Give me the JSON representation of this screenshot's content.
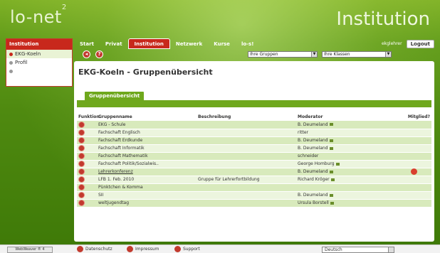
{
  "header": {
    "logo": "lo-net",
    "logo_sup": "2",
    "brand": "Institution"
  },
  "sidebar": {
    "title": "Institution",
    "items": [
      {
        "label": "EKG-Koeln",
        "active": true
      },
      {
        "label": "Profil",
        "active": false
      },
      {
        "label": "",
        "active": false
      }
    ]
  },
  "nav": {
    "tabs": [
      {
        "label": "Start"
      },
      {
        "label": "Privat"
      },
      {
        "label": "Institution",
        "active": true
      },
      {
        "label": "Netzwerk"
      },
      {
        "label": "Kurse"
      },
      {
        "label": "lo-s!"
      }
    ],
    "user": "ekglehrer",
    "logout": "Logout"
  },
  "toolbar": {
    "groups_select": "Ihre Gruppen",
    "classes_select": "Ihre Klassen"
  },
  "main": {
    "title": "EKG-Koeln - Gruppenübersicht",
    "subtab": "Gruppenübersicht",
    "columns": [
      "Funktion",
      "Gruppenname",
      "Beschreibung",
      "Moderator",
      "Mitglied?"
    ],
    "rows": [
      {
        "name": "EKG - Schule",
        "desc": "",
        "moderator": "B. Deumeland",
        "lock": true,
        "member": false,
        "link": false
      },
      {
        "name": "Fachschaft Englisch",
        "desc": "",
        "moderator": "ritter",
        "lock": false,
        "member": false,
        "link": false
      },
      {
        "name": "Fachschaft Erdkunde",
        "desc": "",
        "moderator": "B. Deumeland",
        "lock": true,
        "member": false,
        "link": false
      },
      {
        "name": "Fachschaft Informatik",
        "desc": "",
        "moderator": "B. Deumeland",
        "lock": true,
        "member": false,
        "link": false
      },
      {
        "name": "Fachschaft Mathematik",
        "desc": "",
        "moderator": "schneider",
        "lock": false,
        "member": false,
        "link": false
      },
      {
        "name": "Fachschaft Politik/Sozialwis..",
        "desc": "",
        "moderator": "George Homburg",
        "lock": true,
        "member": false,
        "link": false
      },
      {
        "name": "Lehrerkonferenz",
        "desc": "",
        "moderator": "B. Deumeland",
        "lock": true,
        "member": true,
        "link": true
      },
      {
        "name": "LFB 1. Feb. 2010",
        "desc": "Gruppe für Lehrerfortbildung",
        "moderator": "Richard Kröger",
        "lock": true,
        "member": false,
        "link": false
      },
      {
        "name": "Pünktchen & Komma",
        "desc": "",
        "moderator": "",
        "lock": false,
        "member": false,
        "link": false
      },
      {
        "name": "SII",
        "desc": "",
        "moderator": "B. Deumeland",
        "lock": true,
        "member": false,
        "link": false
      },
      {
        "name": "weltjugendtag",
        "desc": "",
        "moderator": "Ursula Borstell",
        "lock": true,
        "member": false,
        "link": false
      }
    ]
  },
  "footer": {
    "webweaver": "WebWeaver ® 4",
    "links": [
      "Datenschutz",
      "Impressum",
      "Support"
    ],
    "language": "Deutsch"
  },
  "colors": {
    "accent_red": "#c8281c",
    "green": "#6fa81d",
    "row_odd": "#d8eabc",
    "row_even": "#ecf5de"
  }
}
